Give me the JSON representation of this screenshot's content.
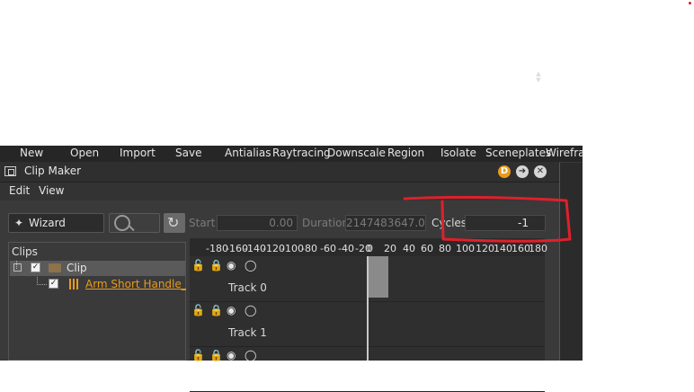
{
  "toolbar": [
    "New",
    "Open",
    "Import",
    "Save",
    "Antialias",
    "Raytracing",
    "Downscale",
    "Region",
    "Isolate",
    "Sceneplates",
    "Wirefram"
  ],
  "window": {
    "title": "Clip Maker",
    "d_button": "D",
    "next_icon": "arrow-right-icon",
    "close_icon": "close-icon"
  },
  "menu": {
    "edit": "Edit",
    "view": "View"
  },
  "controls": {
    "wizard_label": "Wizard",
    "start_label": "Start",
    "start_value": "0.00",
    "duration_label": "Duration",
    "duration_value": "2147483647.00",
    "cycles_label": "Cycles",
    "cycles_value": "-1"
  },
  "clips": {
    "header": "Clips",
    "items": [
      {
        "label": "Clip",
        "checked": true
      },
      {
        "label": "Arm Short Handle_Bl",
        "checked": true
      }
    ]
  },
  "timeline": {
    "ticks": [
      "-180",
      "-160",
      "-140",
      "-120",
      "-100",
      "-80",
      "-60",
      "-40",
      "-20",
      "0",
      "20",
      "40",
      "60",
      "80",
      "100",
      "120",
      "140",
      "160",
      "180"
    ],
    "tracks": [
      {
        "name": "Track 0"
      },
      {
        "name": "Track 1"
      },
      {
        "name": ""
      }
    ]
  },
  "colors": {
    "annotation": "#e0202a",
    "accent": "#e89a1c",
    "panel": "#3a3a3a"
  }
}
